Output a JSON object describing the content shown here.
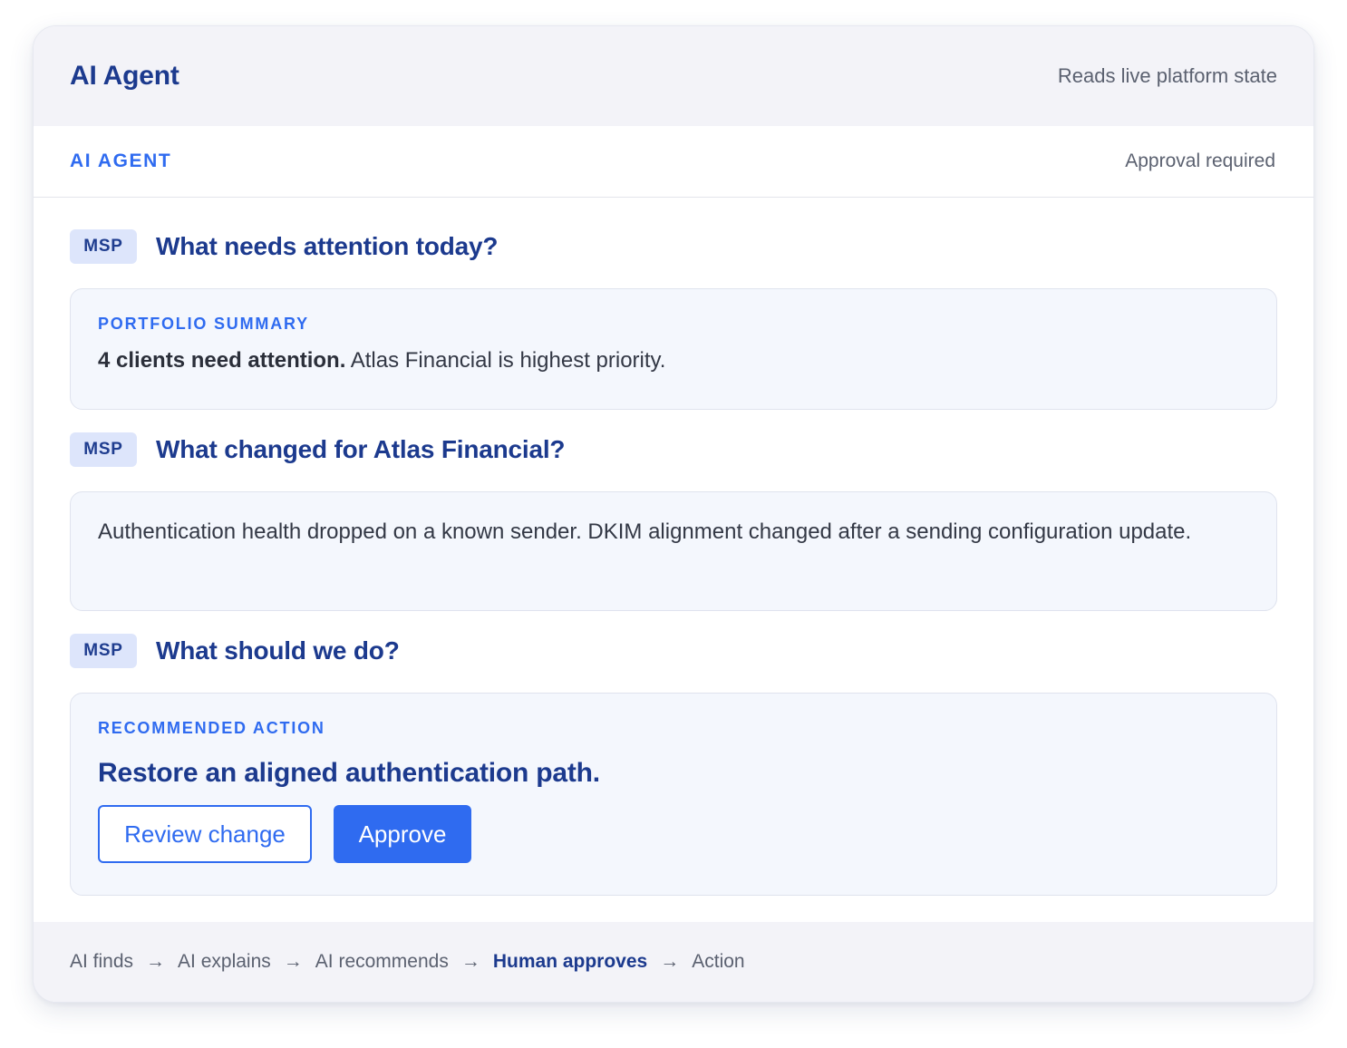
{
  "header": {
    "title": "AI Agent",
    "note": "Reads live platform state"
  },
  "subheader": {
    "label": "AI AGENT",
    "status": "Approval required"
  },
  "conversation": [
    {
      "badge": "MSP",
      "question": "What needs attention today?",
      "answer": {
        "eyebrow": "PORTFOLIO SUMMARY",
        "bold": "4 clients need attention.",
        "text": " Atlas Financial is highest priority."
      }
    },
    {
      "badge": "MSP",
      "question": "What changed for Atlas Financial?",
      "answer": {
        "text": "Authentication health dropped on a known sender. DKIM alignment changed after a sending configuration update."
      }
    },
    {
      "badge": "MSP",
      "question": "What should we do?",
      "answer": {
        "eyebrow": "RECOMMENDED ACTION",
        "title": "Restore an aligned authentication path.",
        "buttons": {
          "review": "Review change",
          "approve": "Approve"
        }
      }
    }
  ],
  "footer": {
    "arrow": "→",
    "steps": [
      "AI finds",
      "AI explains",
      "AI recommends",
      "Human approves",
      "Action"
    ],
    "active_step": "Human approves"
  },
  "colors": {
    "accent": "#2f6bf0",
    "navy": "#1c3a8e",
    "badge_bg": "#dde5fb",
    "panel_bg": "#f4f7fd",
    "bar_bg": "#f3f3f8"
  }
}
